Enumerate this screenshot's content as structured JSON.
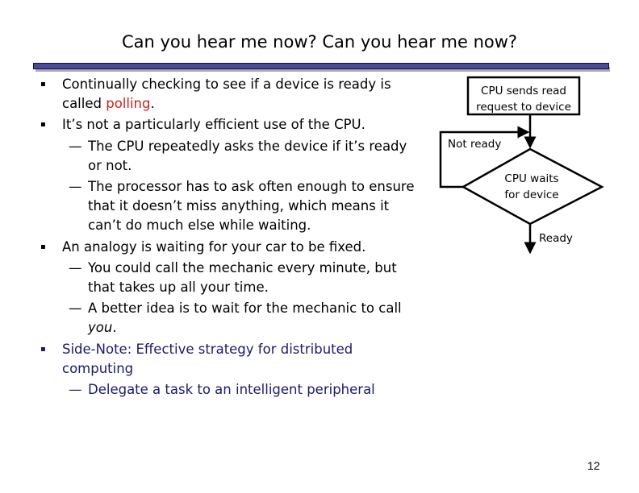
{
  "slide": {
    "title": "Can you hear me now? Can you hear me now?",
    "page_number": "12",
    "colors": {
      "title_rule": "#4a4a9c",
      "highlight": "#cc1f1f",
      "side_note": "#1a1a6e"
    }
  },
  "bullets": [
    {
      "pre": "Continually checking to see if a device is ready is called ",
      "em": "polling",
      "post": "."
    },
    {
      "text": "It’s not a particularly efficient use of the CPU."
    },
    {
      "text": "The CPU repeatedly asks the device if it’s ready or not."
    },
    {
      "text": "The processor has to ask often enough to ensure that it doesn’t miss anything, which means it can’t do much else while waiting."
    },
    {
      "text": "An analogy is waiting for your car to be fixed."
    },
    {
      "text": "You could call the mechanic every minute, but that takes up all your time."
    },
    {
      "pre": "A better idea is to wait for the mechanic to call ",
      "em": "you",
      "post": "."
    },
    {
      "text": "Side-Note: Effective strategy for distributed computing"
    },
    {
      "text": "Delegate a task to an intelligent peripheral"
    }
  ],
  "markers": {
    "bullet": "▪",
    "dash": "—"
  },
  "diagram": {
    "box_line1": "CPU sends read",
    "box_line2": "request to device",
    "loop_label": "Not ready",
    "decision_line1": "CPU waits",
    "decision_line2": "for device",
    "exit_label": "Ready"
  }
}
